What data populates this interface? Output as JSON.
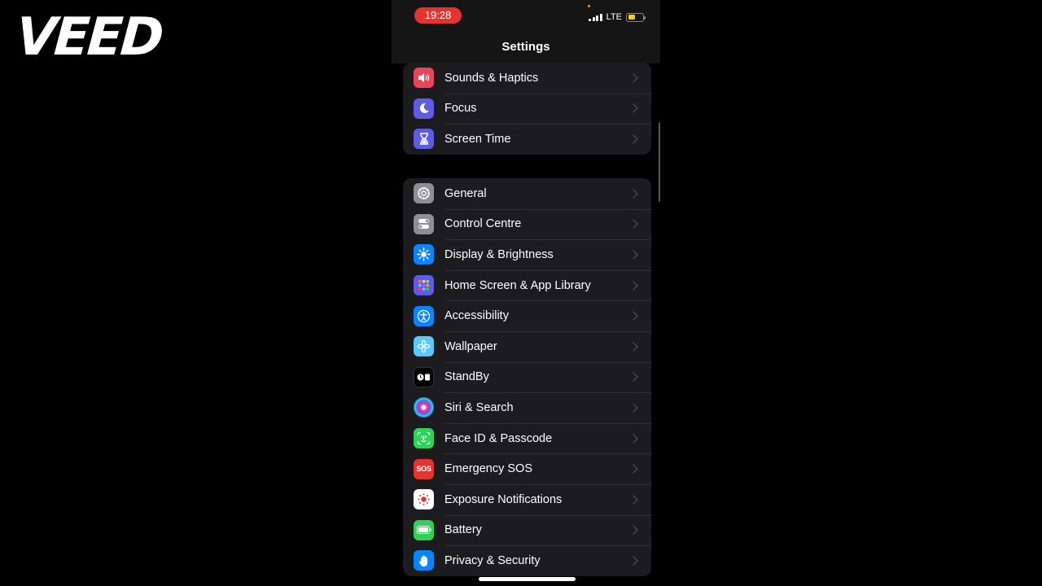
{
  "watermark": "VEED",
  "status_bar": {
    "time": "19:28",
    "network": "LTE"
  },
  "nav": {
    "title": "Settings"
  },
  "groups": [
    {
      "items": [
        {
          "label": "Sounds & Haptics",
          "icon": "speaker-icon",
          "color": "#eb445a"
        },
        {
          "label": "Focus",
          "icon": "moon-icon",
          "color": "#5e5ce6"
        },
        {
          "label": "Screen Time",
          "icon": "hourglass-icon",
          "color": "#5e5ce6"
        }
      ]
    },
    {
      "items": [
        {
          "label": "General",
          "icon": "gear-icon",
          "color": "#8e8e93"
        },
        {
          "label": "Control Centre",
          "icon": "toggles-icon",
          "color": "#8e8e93"
        },
        {
          "label": "Display & Brightness",
          "icon": "sun-icon",
          "color": "#0a84ff"
        },
        {
          "label": "Home Screen & App Library",
          "icon": "app-grid-icon",
          "color": "#5e5ce6"
        },
        {
          "label": "Accessibility",
          "icon": "accessibility-icon",
          "color": "#0a84ff"
        },
        {
          "label": "Wallpaper",
          "icon": "flower-icon",
          "color": "#5ac8fa"
        },
        {
          "label": "StandBy",
          "icon": "standby-icon",
          "color": "#000000"
        },
        {
          "label": "Siri & Search",
          "icon": "siri-icon",
          "color": "#1c1c1e"
        },
        {
          "label": "Face ID & Passcode",
          "icon": "face-id-icon",
          "color": "#30d158"
        },
        {
          "label": "Emergency SOS",
          "icon": "sos-icon",
          "color": "#e5342f"
        },
        {
          "label": "Exposure Notifications",
          "icon": "exposure-icon",
          "color": "#ffffff"
        },
        {
          "label": "Battery",
          "icon": "battery-icon",
          "color": "#30d158"
        },
        {
          "label": "Privacy & Security",
          "icon": "hand-icon",
          "color": "#0a84ff"
        }
      ]
    }
  ]
}
